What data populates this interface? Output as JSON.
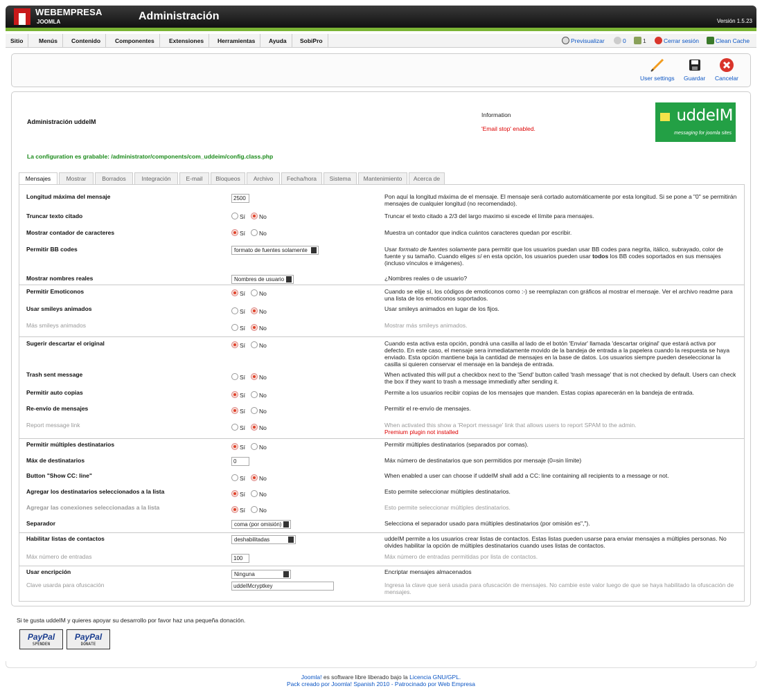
{
  "header": {
    "brand": "WEBEMPRESA",
    "brand_sub": "JOOMLA",
    "title": "Administración",
    "version": "Versión 1.5.23"
  },
  "menu": {
    "items": [
      "Sitio",
      "Menús",
      "Contenido",
      "Componentes",
      "Extensiones",
      "Herramientas",
      "Ayuda",
      "SobiPro"
    ]
  },
  "status": {
    "preview": "Previsualizar",
    "messages_count": "0",
    "users_count": "1",
    "logout": "Cerrar sesión",
    "clean_cache": "Clean Cache"
  },
  "toolbar": {
    "user_settings": "User settings",
    "save": "Guardar",
    "cancel": "Cancelar"
  },
  "page": {
    "admin_title": "Administración uddeIM",
    "info_title": "Information",
    "info_message": "'Email stop' enabled.",
    "config_path": "La configuration es grabable: /administrator/components/com_uddeim/config.class.php",
    "logo_text": "uddeIM",
    "logo_sub": "messaging for joomla sites"
  },
  "tabs": [
    "Mensajes",
    "Mostrar",
    "Borrados",
    "Integración",
    "E-mail",
    "Bloqueos",
    "Archivo",
    "Fecha/hora",
    "Sistema",
    "Mantenimiento",
    "Acerca de"
  ],
  "radio_labels": {
    "yes": "Sí",
    "no": "No"
  },
  "settings": [
    {
      "label": "Longitud máxima del mensaje",
      "input": "2500",
      "desc": "Pon aquí la longitud máxima de el mensaje. El mensaje será cortado automáticamente por esta longitud. Si se pone a \"0\" se permitirán mensajes de cualquier longitud (no recomendado)."
    },
    {
      "label": "Truncar texto citado",
      "selected": "No",
      "desc": "Truncar el texto citado a 2/3 del largo maximo si excede el límite para mensajes."
    },
    {
      "label": "Mostrar contador de caracteres",
      "selected": "Sí",
      "desc": "Muestra un contador que indica cuántos caracteres quedan por escribir."
    },
    {
      "label": "Permitir BB codes",
      "select": "formato de fuentes solamente",
      "desc_pre": "Usar ",
      "desc_em": "formato de fuentes solamente",
      "desc_mid": " para permitir que los usuarios puedan usar BB codes para negrita, itálico, subrayado, color de fuente y su tamaño. Cuando eliges ",
      "desc_em2": "sí",
      "desc_mid2": " en esta opción, los usuarios pueden usar ",
      "desc_b": "todos",
      "desc_post": " los BB codes soportados en sus mensajes (incluso vínculos e imágenes)."
    },
    {
      "label": "Mostrar nombres reales",
      "select": "Nombres de usuario",
      "desc": "¿Nombres reales o de usuario?"
    },
    {
      "label": "Permitir Emoticonos",
      "selected": "Sí",
      "desc": "Cuando se elije sí, los códigos de emoticonos como :-) se reemplazan con gráficos al mostrar el mensaje. Ver el archivo readme para una lista de los emoticonos soportados."
    },
    {
      "label": "Usar smileys animados",
      "selected": "No",
      "desc": "Usar smileys animados en lugar de los fijos."
    },
    {
      "label": "Más smileys animados",
      "selected": "No",
      "desc": "Mostrar más smileys animados."
    },
    {
      "label": "Sugerir descartar el original",
      "selected": "Sí",
      "desc": "Cuando esta activa esta opción, pondrá una casilla al lado de el botón 'Enviar' llamada 'descartar original' que estará activa por defecto. En este caso, el mensaje sera inmediatamente movido de la bandeja de entrada a la papelera cuando la respuesta se haya enviado. Esta opción mantiene baja la cantidad de mensajes en la base de datos. Los usuarios siempre pueden deseleccionar la casilla si quieren conservar el mensaje en la bandeja de entrada."
    },
    {
      "label": "Trash sent message",
      "selected": "No",
      "desc": "When activated this will put a checkbox next to the 'Send' button called 'trash message' that is not checked by default. Users can check the box if they want to trash a message immediatly after sending it."
    },
    {
      "label": "Permitir auto copias",
      "selected": "Sí",
      "desc": "Permite a los usuarios recibir copias de los mensajes que manden. Estas copias aparecerán en la bandeja de entrada."
    },
    {
      "label": "Re-envío de mensajes",
      "selected": "Sí",
      "desc": "Permitir el re-envío de mensajes."
    },
    {
      "label": "Report message link",
      "selected": "No",
      "desc": "When activated this show a 'Report message' link that allows users to report SPAM to the admin.",
      "warn": "Premium plugin not installed"
    },
    {
      "label": "Permitir múltiples destinatarios",
      "selected": "Sí",
      "desc": "Permitir múltiples destinatarios (separados por comas)."
    },
    {
      "label": "Máx de destinatarios",
      "input": "0",
      "desc": "Máx número de destinatarios que son permitidos por mensaje (0=sin límite)"
    },
    {
      "label": "Button \"Show CC: line\"",
      "selected": "No",
      "desc": "When enabled a user can choose if uddeIM shall add a CC: line containing all recipients to a message or not."
    },
    {
      "label": "Agregar los destinatarios seleccionados a la lista",
      "selected": "Sí",
      "desc": "Esto permite seleccionar múltiples destinatarios."
    },
    {
      "label": "Agregar las conexiones seleccionadas a la lista",
      "selected": "Sí",
      "desc": "Esto permite seleccionar múltiples destinatarios."
    },
    {
      "label": "Separador",
      "select": "coma (por omisión)",
      "desc": "Selecciona el separador usado para múltiples destinatarios (por omisión es\",\")."
    },
    {
      "label": "Habilitar listas de contactos",
      "select": "deshabilitadas",
      "desc": "uddeIM permite a los usuarios crear listas de contactos. Estas listas pueden usarse para enviar mensajes a múltiples personas. No olvides habilitar la opción de múltiples destinatarios cuando uses listas de contactos."
    },
    {
      "label": "Máx número de entradas",
      "input": "100",
      "desc": "Máx número de entradas permitidas por lista de contactos."
    },
    {
      "label": "Usar encripción",
      "select": "Ninguna",
      "desc": "Encriptar mensajes almacenados"
    },
    {
      "label": "Clave usarda para ofuscación",
      "input": "uddeIMcryptkey",
      "desc": "Ingresa la clave que será usada para ofuscación de mensajes. No cambie este valor luego de que se haya habilitado la ofuscación de mensajes."
    }
  ],
  "donate": {
    "text": "Si te gusta uddeIM y quieres apoyar su desarrollo por favor haz una pequeña donación.",
    "paypal1_brand": "PayPal",
    "paypal1_sub": "SPENDEN",
    "paypal2_brand": "PayPal",
    "paypal2_sub": "DONATE"
  },
  "footer": {
    "joomla": "Joomla!",
    "line1_mid": " es software libre liberado bajo la ",
    "license": "Licencia GNU/GPL.",
    "line2": "Pack creado por Joomla! Spanish 2010 - Patrocinado por Web Empresa"
  },
  "colors": {
    "accent_green": "#7ab434",
    "link_blue": "#0b55c4",
    "config_green": "#1a8a1a",
    "warn_red": "#dd0000",
    "logo_green": "#23a045"
  }
}
